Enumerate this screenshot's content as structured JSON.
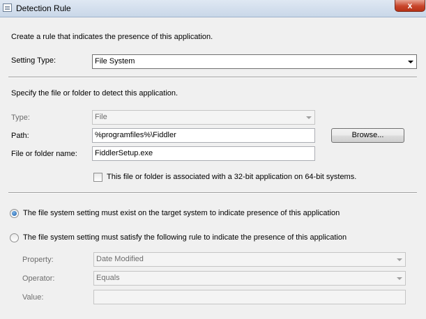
{
  "window": {
    "title": "Detection Rule",
    "close_label": "x"
  },
  "intro": "Create a rule that indicates the presence of this application.",
  "setting_type": {
    "label": "Setting Type:",
    "value": "File System"
  },
  "file_section": {
    "instruction": "Specify the file or folder to detect this application.",
    "type_label": "Type:",
    "type_value": "File",
    "path_label": "Path:",
    "path_value": "%programfiles%\\Fiddler",
    "browse_label": "Browse...",
    "name_label": "File or folder name:",
    "name_value": "FiddlerSetup.exe",
    "checkbox_32bit_label": "This file or folder is associated with a 32-bit application on 64-bit systems.",
    "checkbox_32bit_checked": false
  },
  "options": {
    "exist_label": "The file system setting must exist on the target system to indicate presence of this application",
    "exist_selected": true,
    "rule_label": "The file system setting must satisfy the following rule to indicate the presence of this application",
    "rule_selected": false
  },
  "rule": {
    "property_label": "Property:",
    "property_value": "Date Modified",
    "operator_label": "Operator:",
    "operator_value": "Equals",
    "value_label": "Value:",
    "value_value": ""
  },
  "colors": {
    "window_bg": "#f0f0f0",
    "disabled_text": "#6d6d6d",
    "radio_accent": "#1f5fa8"
  }
}
